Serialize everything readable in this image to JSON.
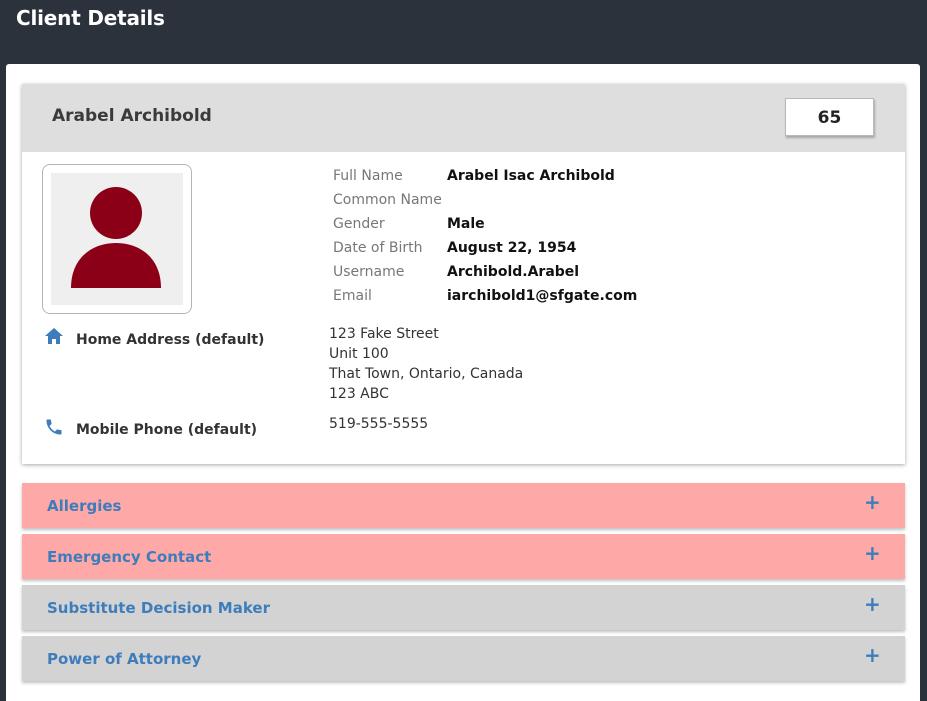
{
  "page": {
    "title": "Client Details"
  },
  "client": {
    "display_name": "Arabel Archibold",
    "score": "65",
    "avatar_icon": "person-icon",
    "avatar_color": "#8b0017",
    "details": [
      {
        "label": "Full Name",
        "value": "Arabel Isac Archibold"
      },
      {
        "label": "Common Name",
        "value": ""
      },
      {
        "label": "Gender",
        "value": "Male"
      },
      {
        "label": "Date of Birth",
        "value": "August 22, 1954"
      },
      {
        "label": "Username",
        "value": "Archibold.Arabel"
      },
      {
        "label": "Email",
        "value": "iarchibold1@sfgate.com"
      }
    ],
    "contacts": {
      "address": {
        "icon": "home-icon",
        "label": "Home Address (default)",
        "lines": [
          "123 Fake Street",
          "Unit 100",
          "That Town, Ontario, Canada",
          "123 ABC"
        ]
      },
      "phone": {
        "icon": "phone-icon",
        "label": "Mobile Phone (default)",
        "value": "519-555-5555"
      }
    }
  },
  "sections": [
    {
      "label": "Allergies",
      "status": "alert",
      "toggle": "+"
    },
    {
      "label": "Emergency Contact",
      "status": "alert",
      "toggle": "+"
    },
    {
      "label": "Substitute Decision Maker",
      "status": "normal",
      "toggle": "+"
    },
    {
      "label": "Power of Attorney",
      "status": "normal",
      "toggle": "+"
    }
  ],
  "colors": {
    "topbar": "#2b323c",
    "alert_section": "#ffa8a8",
    "normal_section": "#d3d3d3",
    "link_blue": "#3d7dbb",
    "icon_blue": "#3d7dbb"
  }
}
